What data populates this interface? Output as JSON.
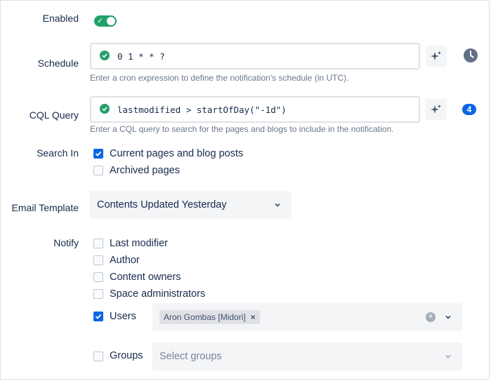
{
  "enabled": {
    "label": "Enabled",
    "on": true
  },
  "schedule": {
    "label": "Schedule",
    "value": "0 1 * * ?",
    "helper": "Enter a cron expression to define the notification's schedule (in UTC).",
    "ai_icon": "sparkle-icon",
    "history_icon": "clock-icon"
  },
  "cql": {
    "label": "CQL Query",
    "value": "lastmodified > startOfDay(\"-1d\")",
    "helper": "Enter a CQL query to search for the pages and blogs to include in the notification.",
    "ai_icon": "sparkle-icon",
    "result_count": "4"
  },
  "search_in": {
    "label": "Search In",
    "options": [
      {
        "label": "Current pages and blog posts",
        "checked": true
      },
      {
        "label": "Archived pages",
        "checked": false
      }
    ]
  },
  "email_template": {
    "label": "Email Template",
    "selected": "Contents Updated Yesterday"
  },
  "notify": {
    "label": "Notify",
    "options": [
      {
        "label": "Last modifier",
        "checked": false
      },
      {
        "label": "Author",
        "checked": false
      },
      {
        "label": "Content owners",
        "checked": false
      },
      {
        "label": "Space administrators",
        "checked": false
      },
      {
        "label": "Users",
        "checked": true
      },
      {
        "label": "Groups",
        "checked": false
      }
    ],
    "users_selected": [
      "Aron Gombas [Midori]"
    ],
    "groups_placeholder": "Select groups"
  },
  "colors": {
    "accent": "#0c66e4",
    "success": "#22a06b"
  }
}
